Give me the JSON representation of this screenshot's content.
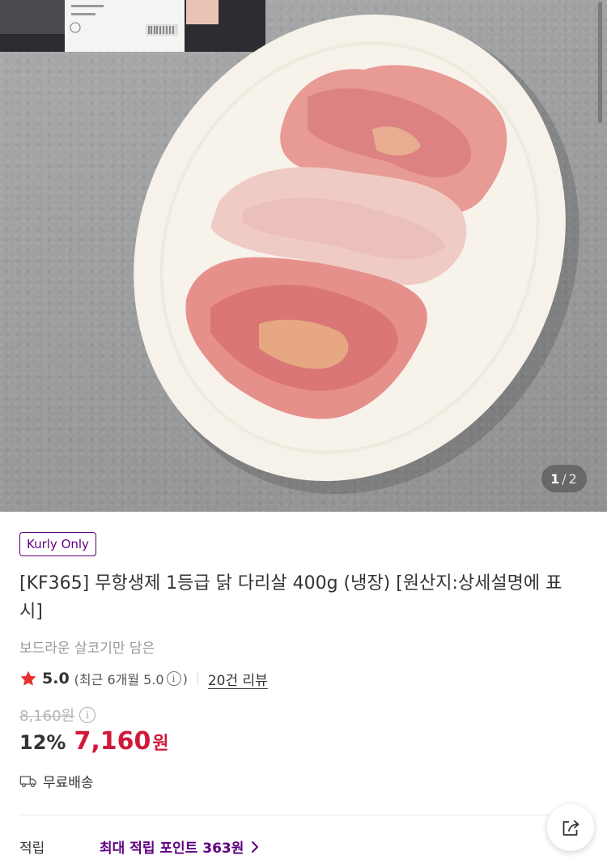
{
  "product": {
    "badge": "Kurly Only",
    "title": "[KF365] 무항생제 1등급 닭 다리살 400g (냉장) [원산지:상세설명에 표시]",
    "subtitle": "보드라운 살코기만 담은"
  },
  "gallery": {
    "current_page": "1",
    "separator": "/",
    "total_pages": "2"
  },
  "rating": {
    "score": "5.0",
    "recent_prefix": "(최근 6개월 5.0",
    "recent_suffix": ")",
    "review_link": "20건 리뷰"
  },
  "pricing": {
    "original_price": "8,160원",
    "discount_rate": "12%",
    "sale_price": "7,160",
    "currency": "원"
  },
  "shipping": {
    "label": "무료배송"
  },
  "points": {
    "label": "적립",
    "value": "최대 적립 포인트 363원"
  },
  "colors": {
    "brand_purple": "#5f0080",
    "price_red": "#d1193a",
    "star_red": "#e8312f"
  },
  "icons": [
    "star-icon",
    "info-icon",
    "truck-icon",
    "chevron-right-icon",
    "share-icon"
  ]
}
